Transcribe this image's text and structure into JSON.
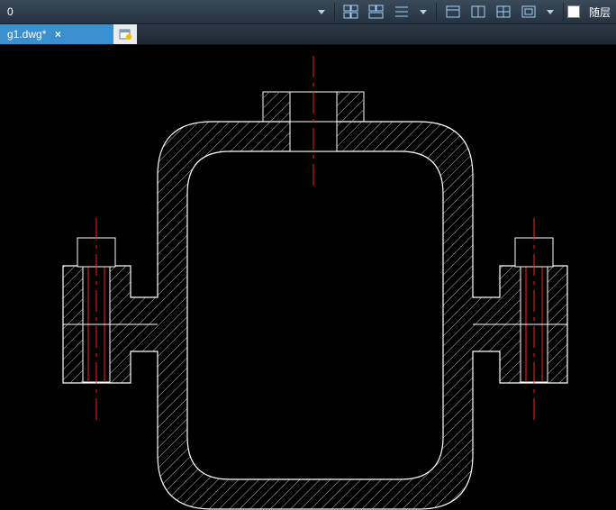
{
  "toolbar": {
    "value": "0",
    "layer_label": "随层"
  },
  "tabs": {
    "active": {
      "name": "g1.dwg*",
      "modified": true
    }
  },
  "drawing": {
    "hatch_color": "#b8b8c8",
    "outline_color": "#ffffff",
    "center_color": "#ff2020",
    "bg": "#000000"
  }
}
